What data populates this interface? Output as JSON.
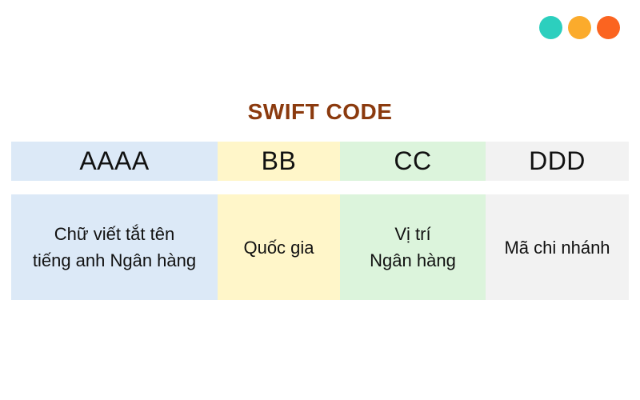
{
  "decor": {
    "dots": [
      {
        "name": "teal",
        "color": "#2ccfbe"
      },
      {
        "name": "amber",
        "color": "#fbab2c"
      },
      {
        "name": "orange",
        "color": "#fb6420"
      }
    ]
  },
  "title": "SWIFT CODE",
  "columns": [
    {
      "code": "AAAA",
      "description_lines": [
        "Chữ viết tắt tên",
        "tiếng anh Ngân hàng"
      ],
      "color": "#dce9f7"
    },
    {
      "code": "BB",
      "description_lines": [
        "Quốc gia"
      ],
      "color": "#fff6c9"
    },
    {
      "code": "CC",
      "description_lines": [
        "Vị trí",
        "Ngân hàng"
      ],
      "color": "#dcf4dc"
    },
    {
      "code": "DDD",
      "description_lines": [
        "Mã chi nhánh"
      ],
      "color": "#f2f2f2"
    }
  ]
}
